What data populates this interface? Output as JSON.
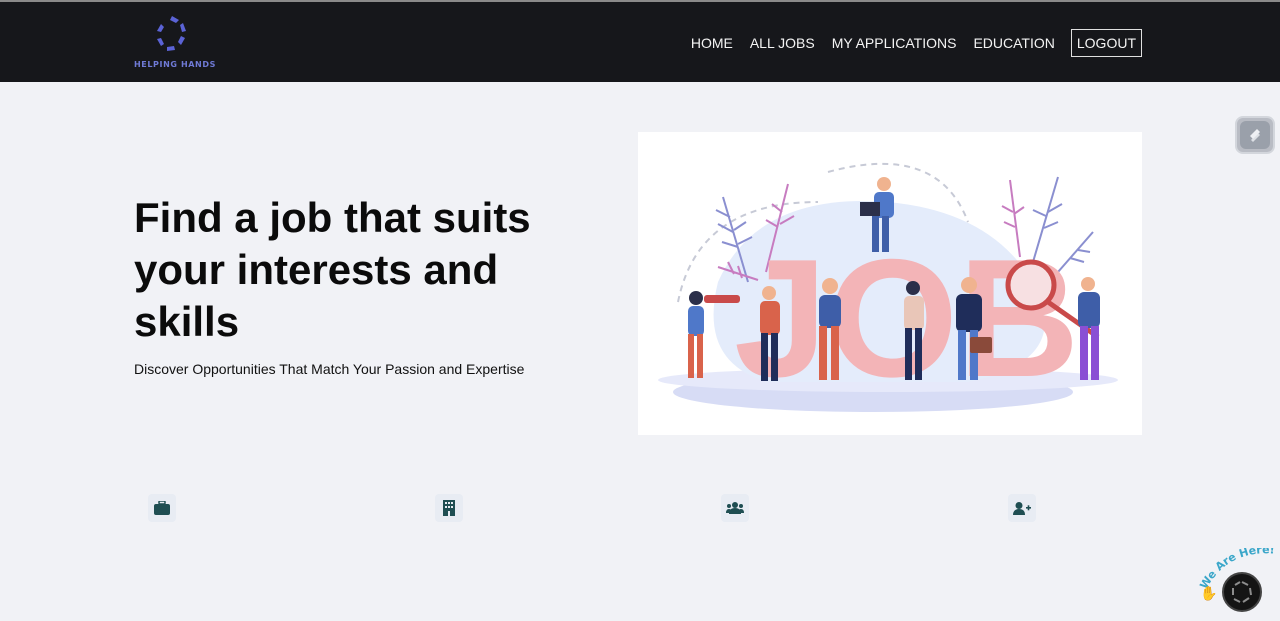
{
  "brand": {
    "name": "HELPING HANDS",
    "color": "#6f7ad6"
  },
  "nav": {
    "home": "HOME",
    "all_jobs": "ALL JOBS",
    "my_applications": "MY APPLICATIONS",
    "education": "EDUCATION",
    "logout": "LOGOUT"
  },
  "hero": {
    "title": "Find a job that suits your interests and skills",
    "subtitle": "Discover Opportunities That Match Your Passion and Expertise",
    "illustration_text": "JOB"
  },
  "features": [
    {
      "icon": "briefcase-icon"
    },
    {
      "icon": "building-icon"
    },
    {
      "icon": "users-icon"
    },
    {
      "icon": "user-plus-icon"
    }
  ],
  "chat_widget": {
    "label": "We Are Here!"
  },
  "colors": {
    "navbar": "#16171b",
    "page_bg": "#f1f2f6",
    "icon_color": "#1f4e52",
    "job_letters": "#f3b4b7"
  }
}
